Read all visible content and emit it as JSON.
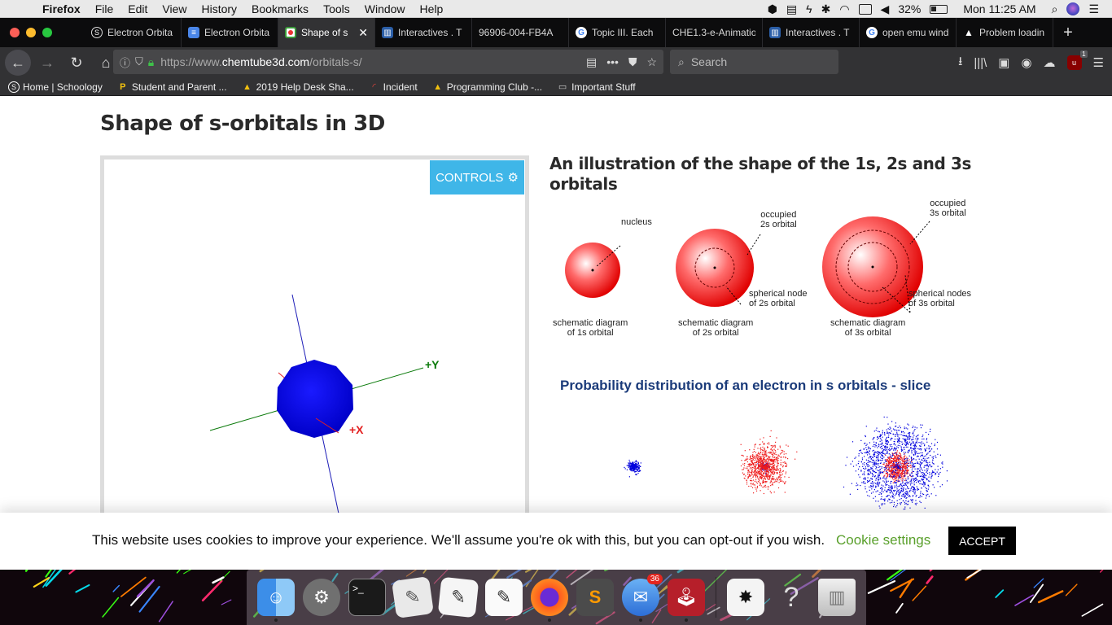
{
  "menubar": {
    "app": "Firefox",
    "items": [
      "File",
      "Edit",
      "View",
      "History",
      "Bookmarks",
      "Tools",
      "Window",
      "Help"
    ],
    "battery": "32%",
    "clock": "Mon 11:25 AM"
  },
  "tabs": [
    {
      "label": "Electron Orbita",
      "icon": "schoology-icon",
      "active": false
    },
    {
      "label": "Electron Orbita",
      "icon": "docs-icon",
      "active": false
    },
    {
      "label": "Shape of s",
      "icon": "chemtube-icon",
      "active": true
    },
    {
      "label": "Interactives . T",
      "icon": "interactives-icon",
      "active": false
    },
    {
      "label": "96906-004-FB4A",
      "icon": "none",
      "active": false
    },
    {
      "label": "Topic III. Each",
      "icon": "google-icon",
      "active": false
    },
    {
      "label": "CHE1.3-e-Animatio",
      "icon": "none",
      "active": false
    },
    {
      "label": "Interactives . T",
      "icon": "interactives-icon",
      "active": false
    },
    {
      "label": "open emu wind",
      "icon": "google-icon",
      "active": false
    },
    {
      "label": "Problem loadin",
      "icon": "warning-icon",
      "active": false
    }
  ],
  "nav": {
    "url_prefix": "https://www.",
    "url_host": "chemtube3d.com",
    "url_path": "/orbitals-s/",
    "search_placeholder": "Search",
    "ublock_count": "1"
  },
  "bookmarks": [
    {
      "label": "Home | Schoology",
      "icon": "schoology-icon"
    },
    {
      "label": "Student and Parent ...",
      "icon": "powerschool-icon"
    },
    {
      "label": "2019 Help Desk Sha...",
      "icon": "drive-icon"
    },
    {
      "label": "Incident",
      "icon": "incident-icon"
    },
    {
      "label": "Programming Club -...",
      "icon": "drive-icon"
    },
    {
      "label": "Important Stuff",
      "icon": "folder-icon"
    }
  ],
  "page": {
    "title": "Shape of s-orbitals in 3D",
    "controls_label": "CONTROLS",
    "axis_y": "+Y",
    "axis_x": "+X",
    "right_title": "An illustration of the shape of the 1s, 2s and 3s orbitals",
    "diagram_labels": {
      "nucleus": "nucleus",
      "occ2": "occupied\n2s orbital",
      "occ3": "occupied\n3s orbital",
      "node2": "spherical node\nof 2s orbital",
      "node3": "spherical nodes\nof 3s orbital",
      "cap1": "schematic diagram\nof 1s orbital",
      "cap2": "schematic diagram\nof 2s orbital",
      "cap3": "schematic diagram\nof 3s orbital"
    },
    "prob_title": "Probability distribution of an electron in s orbitals - slice"
  },
  "cookie": {
    "text": "This website uses cookies to improve your experience. We'll assume you're ok with this, but you can opt-out if you wish.",
    "settings": "Cookie settings",
    "accept": "ACCEPT"
  },
  "dock": {
    "items": [
      "finder-icon",
      "system-preferences-icon",
      "terminal-icon",
      "script-editor-icon",
      "textedit-icon",
      "textedit2-icon",
      "firefox-icon",
      "sublime-text-icon",
      "mail-icon",
      "openemu-icon",
      "preview-icon",
      "help-icon",
      "trash-icon"
    ],
    "mail_badge": "36"
  },
  "colors": {
    "accent": "#3fb6e8",
    "cookie_link": "#5aa02c",
    "orbital_blue": "#0000dd",
    "orbital_red": "#ee1b1b"
  }
}
